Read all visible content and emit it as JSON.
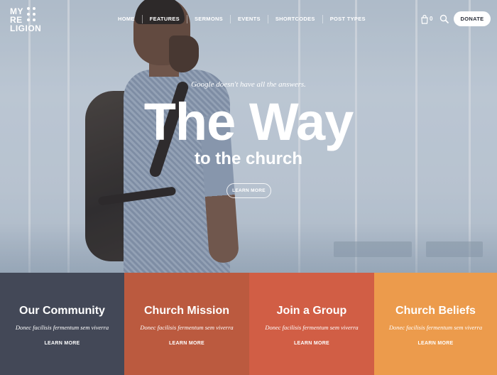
{
  "brand": {
    "line1": "MY",
    "line2": "RE",
    "line3": "LIGION"
  },
  "nav": {
    "items": [
      "HOME",
      "FEATURES",
      "SERMONS",
      "EVENTS",
      "SHORTCODES",
      "POST TYPES"
    ],
    "cart_count": "0",
    "donate_label": "DONATE",
    "icons": {
      "cart": "shopping-bag-icon",
      "search": "search-icon"
    }
  },
  "hero": {
    "tagline": "Google doesn't have all the answers.",
    "title": "The Way",
    "subtitle": "to the church",
    "button_label": "LEARN MORE"
  },
  "tiles": [
    {
      "title": "Our Community",
      "subtitle": "Donec facilisis fermentum sem viverra",
      "link": "LEARN MORE",
      "color": "#434857"
    },
    {
      "title": "Church Mission",
      "subtitle": "Donec facilisis fermentum sem viverra",
      "link": "LEARN MORE",
      "color": "#bb5a3f"
    },
    {
      "title": "Join a Group",
      "subtitle": "Donec facilisis fermentum sem viverra",
      "link": "LEARN MORE",
      "color": "#d15e45"
    },
    {
      "title": "Church Beliefs",
      "subtitle": "Donec facilisis fermentum sem viverra",
      "link": "LEARN MORE",
      "color": "#ec9b4c"
    }
  ]
}
